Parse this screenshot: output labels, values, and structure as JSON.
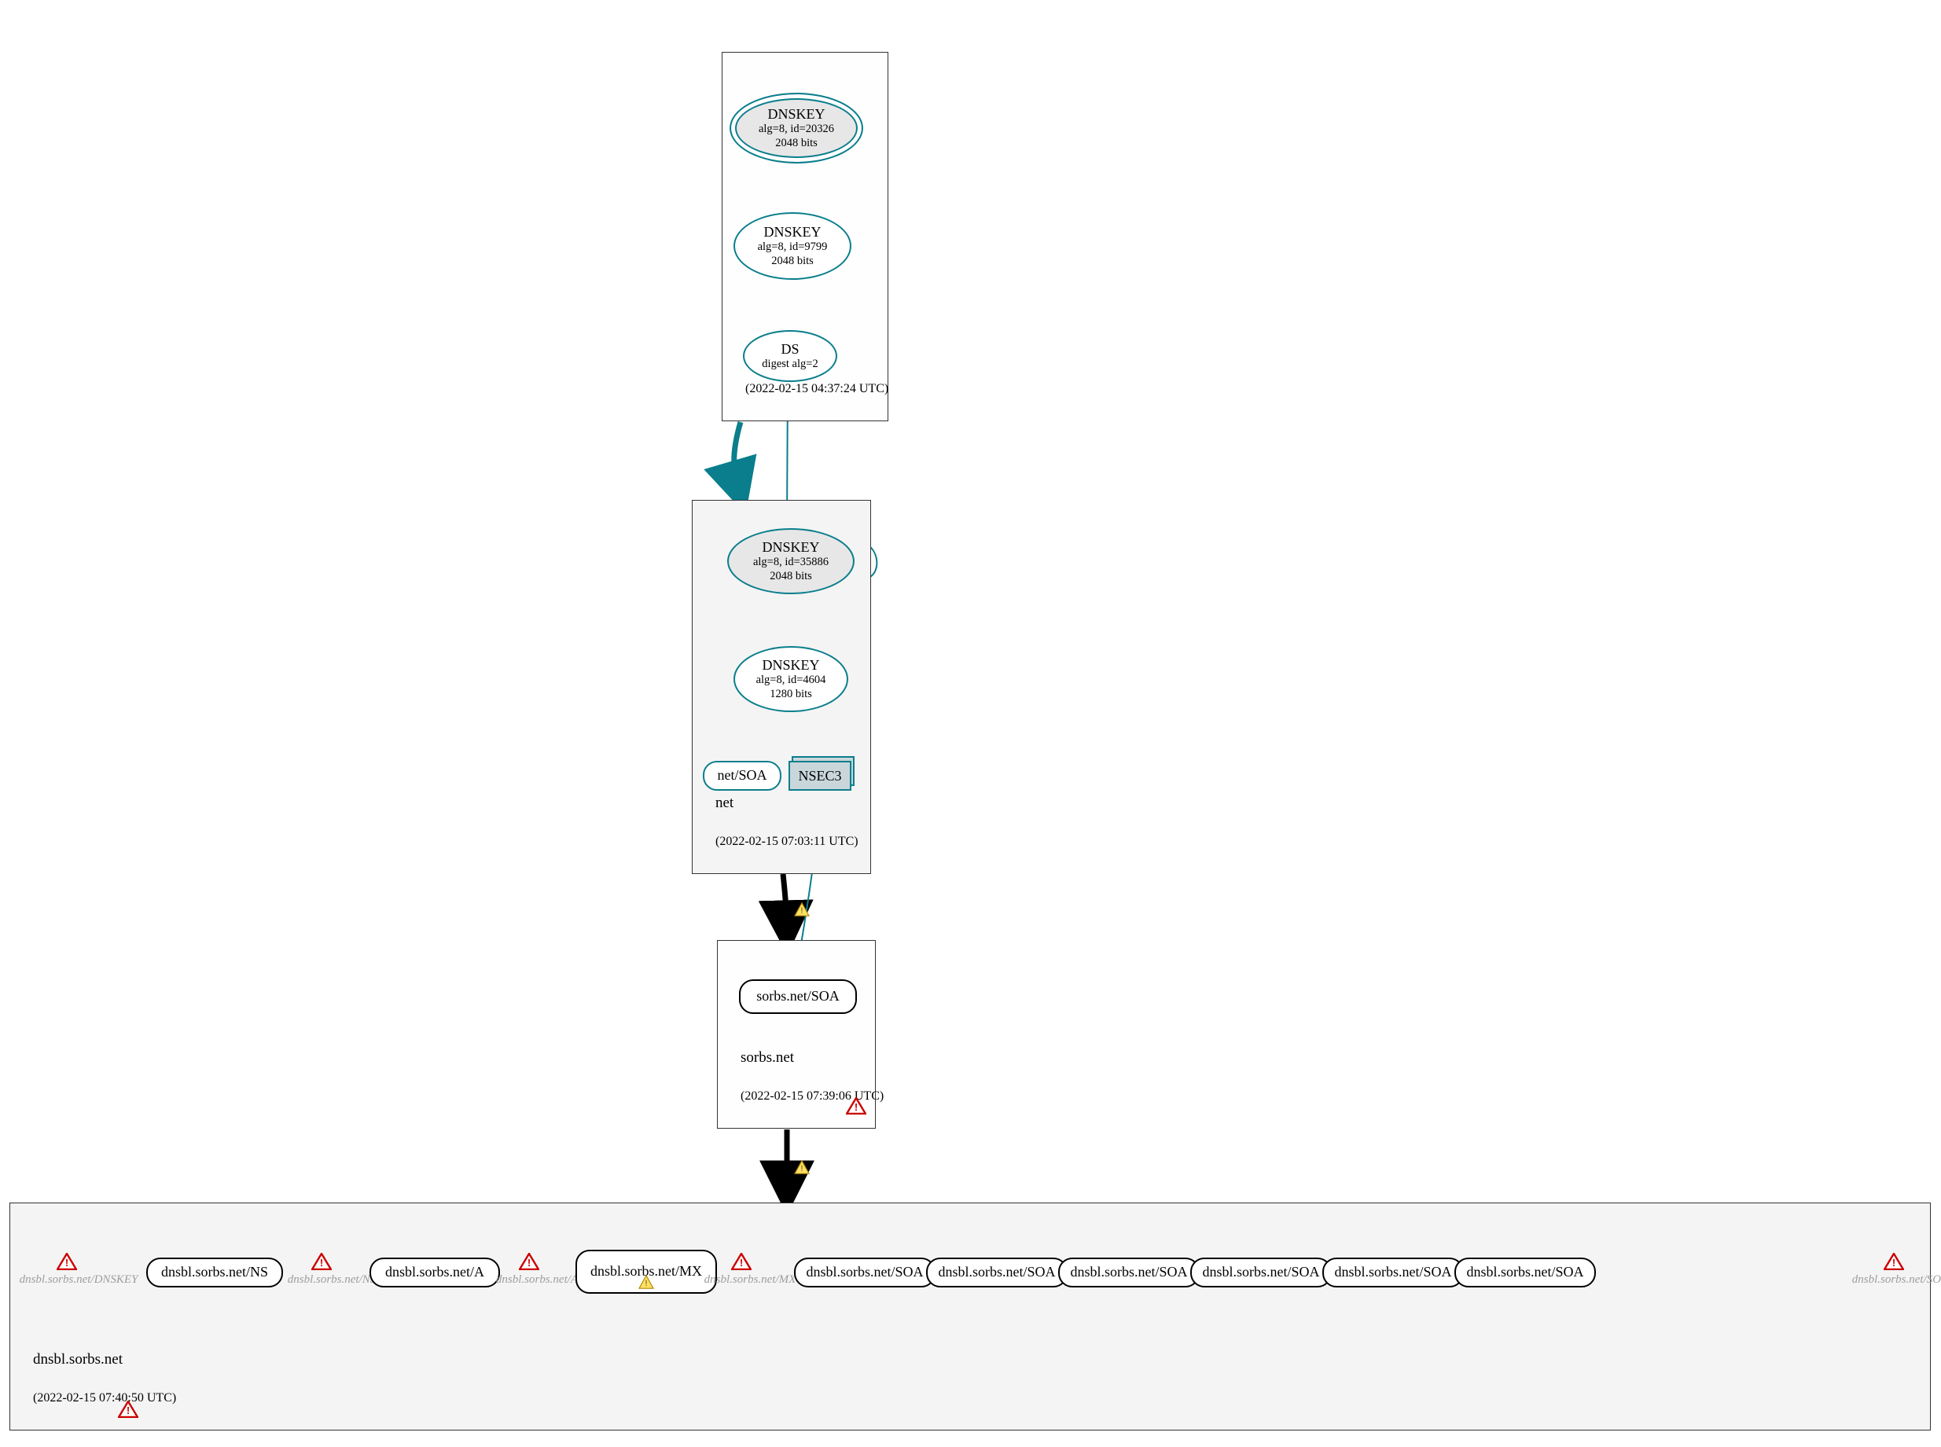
{
  "zones": {
    "root": {
      "name": ".",
      "timestamp": "(2022-02-15 04:37:24 UTC)"
    },
    "net": {
      "name": "net",
      "timestamp": "(2022-02-15 07:03:11 UTC)"
    },
    "sorbs": {
      "name": "sorbs.net",
      "timestamp": "(2022-02-15 07:39:06 UTC)"
    },
    "dnsbl": {
      "name": "dnsbl.sorbs.net",
      "timestamp": "(2022-02-15 07:40:50 UTC)"
    }
  },
  "nodes": {
    "root_ksk": {
      "title": "DNSKEY",
      "sub1": "alg=8, id=20326",
      "sub2": "2048 bits"
    },
    "root_zsk": {
      "title": "DNSKEY",
      "sub1": "alg=8, id=9799",
      "sub2": "2048 bits"
    },
    "root_ds": {
      "title": "DS",
      "sub1": "digest alg=2"
    },
    "net_ksk": {
      "title": "DNSKEY",
      "sub1": "alg=8, id=35886",
      "sub2": "2048 bits"
    },
    "net_zsk": {
      "title": "DNSKEY",
      "sub1": "alg=8, id=4604",
      "sub2": "1280 bits"
    },
    "net_soa": {
      "label": "net/SOA"
    },
    "nsec3": {
      "label": "NSEC3"
    },
    "sorbs_soa": {
      "label": "sorbs.net/SOA"
    },
    "dnsbl_ns": {
      "label": "dnsbl.sorbs.net/NS"
    },
    "dnsbl_a": {
      "label": "dnsbl.sorbs.net/A"
    },
    "dnsbl_mx": {
      "label": "dnsbl.sorbs.net/MX"
    },
    "dnsbl_soa": {
      "label": "dnsbl.sorbs.net/SOA"
    }
  },
  "ghosts": {
    "dnskey": "dnsbl.sorbs.net/DNSKEY",
    "ns": "dnsbl.sorbs.net/NS",
    "a": "dnsbl.sorbs.net/A",
    "mx": "dnsbl.sorbs.net/MX",
    "soa": "dnsbl.sorbs.net/SOA"
  }
}
